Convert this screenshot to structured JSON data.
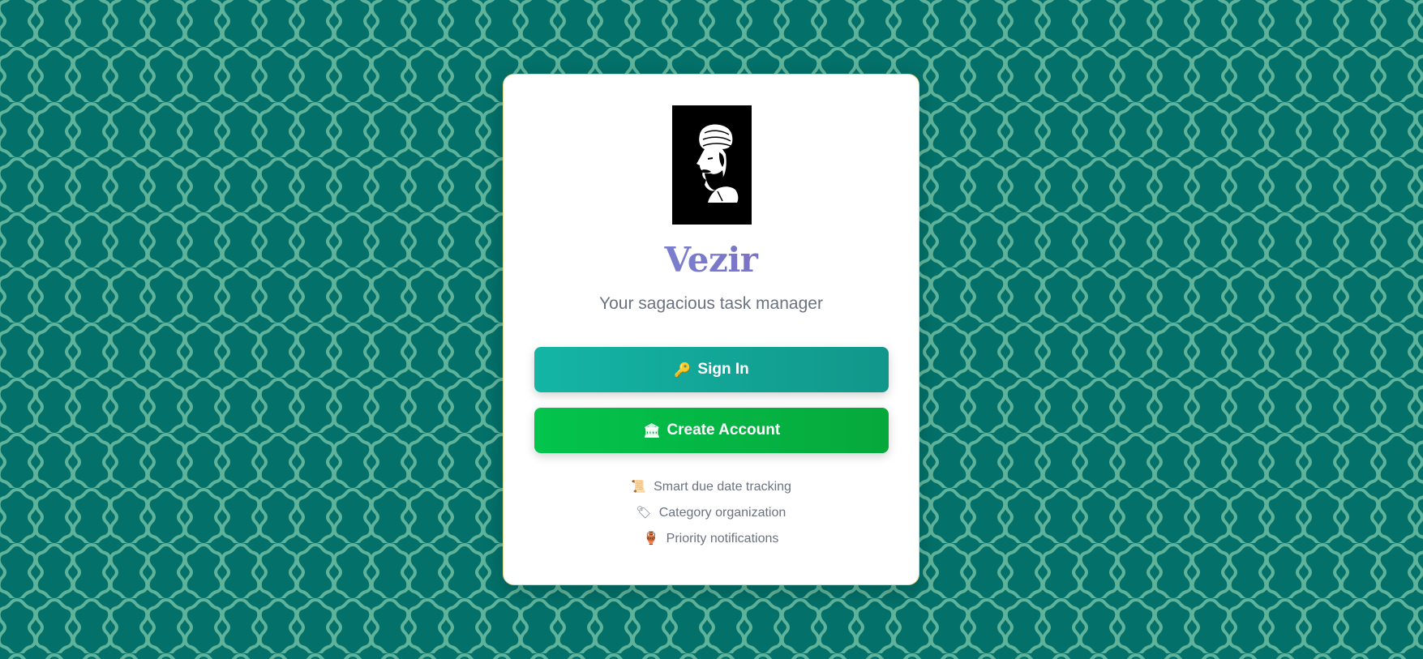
{
  "app": {
    "title": "Vezir",
    "subtitle": "Your sagacious task manager"
  },
  "logo": {
    "icon": "vizier-turban-portrait-icon"
  },
  "actions": {
    "sign_in": {
      "label": "Sign In",
      "icon": "key-icon",
      "glyph": "🔑"
    },
    "create_account": {
      "label": "Create Account",
      "icon": "classical-building-icon",
      "glyph": "🏛"
    }
  },
  "features": [
    {
      "label": "Smart due date tracking",
      "icon": "scroll-icon",
      "glyph": "📜"
    },
    {
      "label": "Category organization",
      "icon": "label-tag-icon",
      "glyph": "🏷"
    },
    {
      "label": "Priority notifications",
      "icon": "amphora-icon",
      "glyph": "🏺"
    }
  ],
  "colors": {
    "background": "#037069",
    "pattern": "#5fb39a",
    "title_gradient_start": "#7b8fdb",
    "title_gradient_end": "#7a63b8",
    "sign_in_button": "#13a898",
    "create_account_button": "#04b846",
    "card_border": "#e7d98a"
  }
}
